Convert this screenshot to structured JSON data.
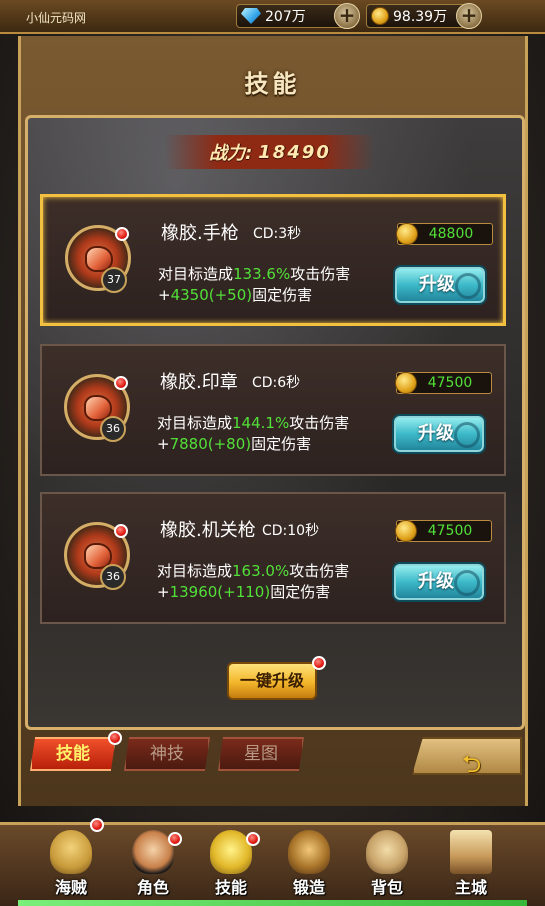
{
  "watermark": "小仙元码网",
  "resources": {
    "gems": "207万",
    "gold": "98.39万"
  },
  "title": "技能",
  "power": {
    "label": "战力:",
    "value": "18490"
  },
  "skills": [
    {
      "name": "橡胶.手枪",
      "cd": "CD:3秒",
      "level": "37",
      "cost": "48800",
      "desc_prefix": "对目标造成",
      "percent": "133.6%",
      "desc_mid": "攻击伤害",
      "plus": "+",
      "damage": "4350(+50)",
      "desc_suffix": "固定伤害",
      "button": "升级"
    },
    {
      "name": "橡胶.印章",
      "cd": "CD:6秒",
      "level": "36",
      "cost": "47500",
      "desc_prefix": "对目标造成",
      "percent": "144.1%",
      "desc_mid": "攻击伤害",
      "plus": "+",
      "damage": "7880(+80)",
      "desc_suffix": "固定伤害",
      "button": "升级"
    },
    {
      "name": "橡胶.机关枪",
      "cd": "CD:10秒",
      "level": "36",
      "cost": "47500",
      "desc_prefix": "对目标造成",
      "percent": "163.0%",
      "desc_mid": "攻击伤害",
      "plus": "+",
      "damage": "13960(+110)",
      "desc_suffix": "固定伤害",
      "button": "升级"
    }
  ],
  "onekey_button": "一键升级",
  "tabs": [
    "技能",
    "神技",
    "星图"
  ],
  "nav": [
    "海贼",
    "角色",
    "技能",
    "锻造",
    "背包",
    "主城"
  ],
  "colors": {
    "highlight_green": "#52e038",
    "selected_border": "#f2c140",
    "upgrade_button": "#3cb9c8",
    "active_tab": "#f0502a"
  }
}
